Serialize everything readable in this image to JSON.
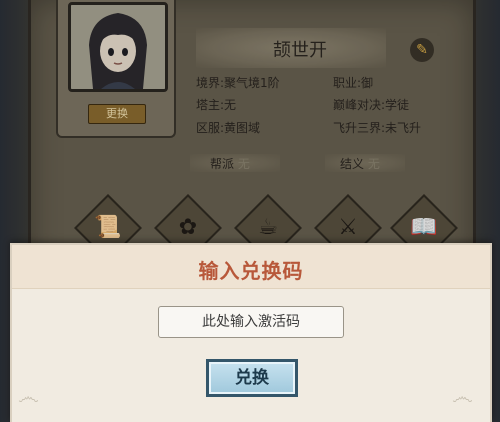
{
  "profile": {
    "change_avatar_label": "更换",
    "name": "颉世开",
    "info_left": [
      "境界:聚气境1阶",
      "塔主:无",
      "区服:黄图域"
    ],
    "info_right": [
      "职业:御",
      "巅峰对决:学徒",
      "飞升三界:未飞升"
    ],
    "sect_label": "帮派",
    "sect_value": "无",
    "partner_label": "结义",
    "partner_value": "无"
  },
  "menu_icons": [
    "scroll-icon",
    "flower-icon",
    "teapot-icon",
    "sword-icon",
    "book-icon"
  ],
  "dialog": {
    "title": "输入兑换码",
    "input_placeholder": "此处输入激活码",
    "input_value": "",
    "redeem_label": "兑换"
  },
  "colors": {
    "dialog_title": "#b8583a",
    "button_border": "#34566a",
    "button_fill": "#b6d6e6"
  }
}
